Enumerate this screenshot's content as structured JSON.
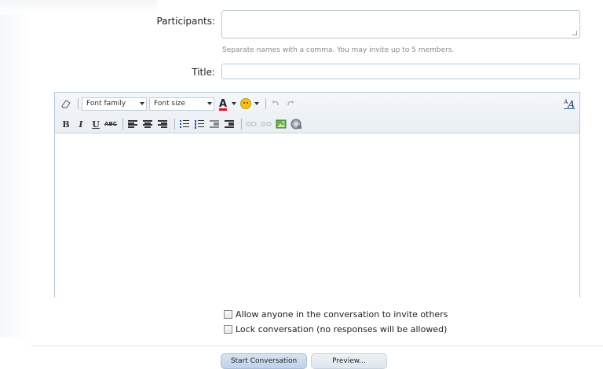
{
  "form": {
    "participants_label": "Participants:",
    "participants_value": "",
    "participants_hint": "Separate names with a comma. You may invite up to 5 members.",
    "title_label": "Title:",
    "title_value": ""
  },
  "toolbar": {
    "font_family": "Font family",
    "font_size": "Font size",
    "bold": "B",
    "italic": "I",
    "underline": "U",
    "strikethrough": "ABC",
    "font_color": "A",
    "remove_format_sup": "A",
    "remove_format": "A",
    "icons_row1": [
      "eraser-icon",
      "font-color-icon",
      "smilies-icon",
      "undo-icon",
      "redo-icon",
      "remove-format-icon"
    ],
    "icons_row2": [
      "align-left-icon",
      "align-center-icon",
      "align-right-icon",
      "bullet-list-icon",
      "numbered-list-icon",
      "outdent-icon",
      "indent-icon",
      "link-icon",
      "unlink-icon",
      "image-icon",
      "media-icon"
    ]
  },
  "options": {
    "allow_invite_label": "Allow anyone in the conversation to invite others",
    "allow_invite_checked": false,
    "lock_label": "Lock conversation (no responses will be allowed)",
    "lock_checked": false
  },
  "actions": {
    "submit_label": "Start Conversation",
    "preview_label": "Preview..."
  },
  "colors": {
    "border": "#b8c7d9",
    "primary_button": "#c8d9ec",
    "hint_text": "#888888"
  }
}
